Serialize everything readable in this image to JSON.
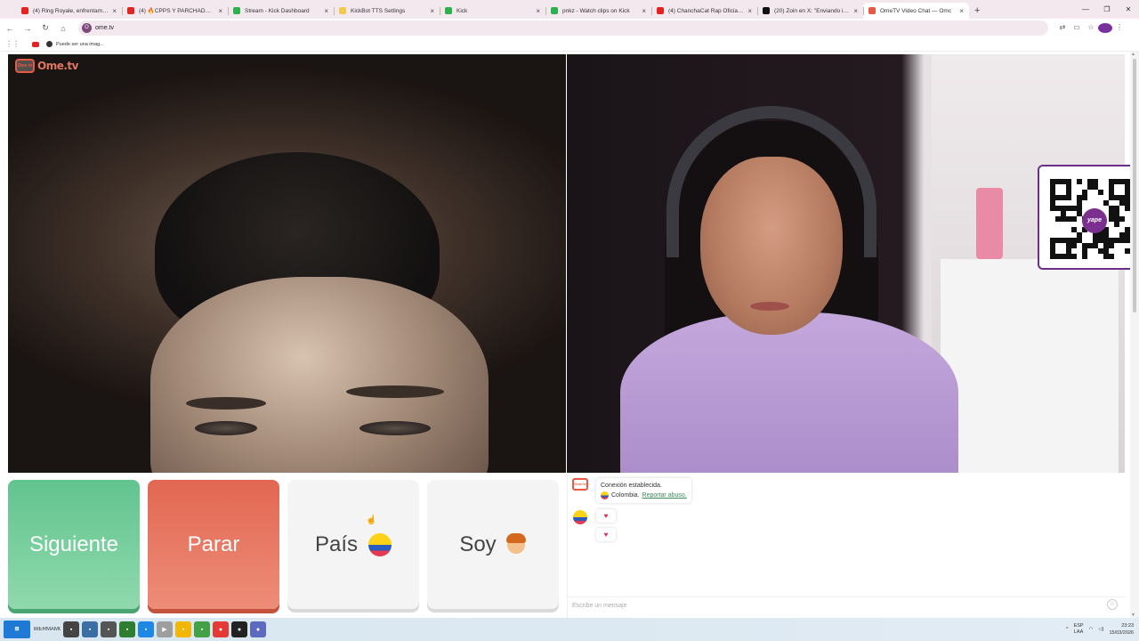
{
  "browser": {
    "tabs": [
      {
        "title": "(4) Ring Royale, enfrentamient",
        "fav_color": "#e52222",
        "active": false
      },
      {
        "title": "(4) 🔥CPPS Y PARCHADAS🔥 E",
        "fav_color": "#e52222",
        "active": false
      },
      {
        "title": "Stream - Kick Dashboard",
        "fav_color": "#2bb24c",
        "active": false
      },
      {
        "title": "KickBot TTS Settings",
        "fav_color": "#f2c94c",
        "active": false
      },
      {
        "title": "Kick",
        "fav_color": "#2bb24c",
        "active": false
      },
      {
        "title": "pnkz - Watch clips on Kick",
        "fav_color": "#2bb24c",
        "active": false
      },
      {
        "title": "(4) ChanchaCat Rap Oficial - Yo",
        "fav_color": "#e52222",
        "active": false
      },
      {
        "title": "(20) Zoin en X: \"Enviando invita",
        "fav_color": "#111111",
        "active": false
      },
      {
        "title": "OmeTV Video Chat — Omc",
        "fav_color": "#e65a45",
        "active": true
      }
    ],
    "new_tab_label": "+",
    "url": "ome.tv",
    "profile_initial": "J",
    "bookmark_label": "Puede ser una imag...",
    "window_controls": [
      "—",
      "❐",
      "✕"
    ]
  },
  "ome": {
    "logo_text": "Ome.tv",
    "logo_tv": "Ome tv"
  },
  "qr": {
    "badge_text": "yape"
  },
  "buttons": {
    "next_label": "Siguiente",
    "stop_label": "Parar",
    "country_label": "País",
    "gender_label": "Soy"
  },
  "chat": {
    "system_line1": "Conexión establecida.",
    "system_country": "Colombia.",
    "report_label": "Reportar abuso.",
    "messages": [
      "♥",
      "♥"
    ],
    "input_placeholder": "Escribe un mensaje",
    "logo_tv": "Ome tv"
  },
  "taskbar": {
    "label": "BIERMAMOMAS3",
    "lang_top": "ESP",
    "lang_bottom": "LAA",
    "time": "23:23",
    "date": "15/03/2026"
  }
}
